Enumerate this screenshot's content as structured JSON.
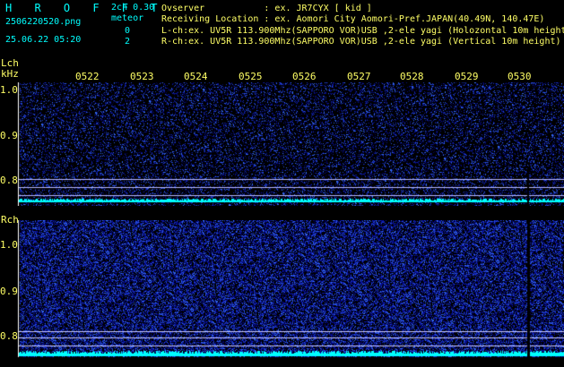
{
  "app": {
    "logo": "H R O F F T",
    "filename": "2506220520.png",
    "datetime": "25.06.22 05:20"
  },
  "meta": {
    "version": "2ch 0.30",
    "meteor_label": "meteor",
    "meteor_lch": "0",
    "meteor_rch": "2"
  },
  "info": {
    "observer": "Ovserver           : ex. JR7CYX [ kid ]",
    "location": "Receiving Location : ex. Aomori City Aomori-Pref.JAPAN(40.49N, 140.47E)",
    "lch": "L-ch:ex. UV5R 113.900Mhz(SAPPORO VOR)USB ,2-ele yagi (Holozontal 10m height)",
    "rch": "R-ch:ex. UV5R 113.900Mhz(SAPPORO VOR)USB ,2-ele yagi (Vertical 10m height)"
  },
  "lch_panel": {
    "label": "Lch",
    "unit": "kHz",
    "time_ticks": [
      "0522",
      "0523",
      "0524",
      "0525",
      "0526",
      "0527",
      "0528",
      "0529",
      "0530"
    ],
    "freq_labels": [
      "1.0",
      "0.9",
      "0.8"
    ]
  },
  "rch_panel": {
    "label": "Rch",
    "freq_labels": [
      "1.0",
      "0.9",
      "0.8"
    ]
  },
  "colors": {
    "background": "#000000",
    "text_yellow": "#ffff66",
    "text_cyan": "#00ffff",
    "noise_blue": "#2a3cff",
    "carrier_cyan": "#00ffff"
  }
}
